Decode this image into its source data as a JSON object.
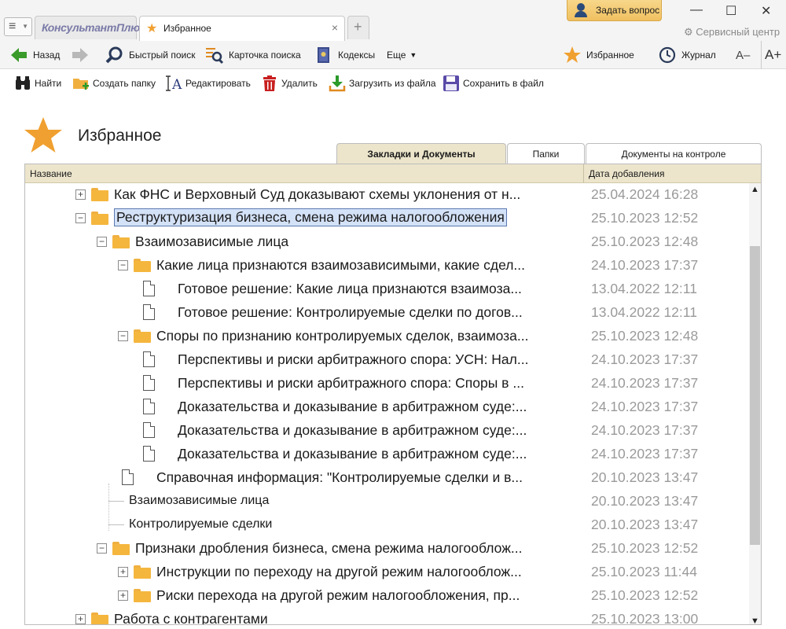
{
  "window": {
    "app_logo": "КонсультантПлюс",
    "active_tab_label": "Избранное",
    "close_glyph": "×",
    "new_tab_glyph": "+",
    "ask_button": "Задать вопрос",
    "service_center": "Сервисный центр",
    "minimize": "—",
    "maximize": "☐",
    "close": "✕"
  },
  "toolbar": {
    "back": "Назад",
    "quick_search": "Быстрый поиск",
    "search_card": "Карточка поиска",
    "codexes": "Кодексы",
    "more": "Еще",
    "favorites": "Избранное",
    "journal": "Журнал",
    "font_smaller": "A–",
    "font_larger": "A+"
  },
  "actions": {
    "find": "Найти",
    "create_folder": "Создать папку",
    "edit": "Редактировать",
    "delete": "Удалить",
    "load_from_file": "Загрузить из файла",
    "save_to_file": "Сохранить в файл"
  },
  "page": {
    "title": "Избранное"
  },
  "view_tabs": [
    {
      "label": "Закладки и Документы",
      "selected": true
    },
    {
      "label": "Папки",
      "selected": false
    },
    {
      "label": "Документы на контроле",
      "selected": false
    }
  ],
  "table": {
    "col_name": "Название",
    "col_date": "Дата добавления",
    "rows": [
      {
        "level": 0,
        "type": "folder",
        "toggle": "+",
        "name": "Как ФНС и Верховный Суд доказывают схемы уклонения от н...",
        "date": "25.04.2024 16:28"
      },
      {
        "level": 0,
        "type": "folder",
        "toggle": "−",
        "name": "Реструктуризация бизнеса, смена режима налогообложения",
        "date": "25.10.2023 12:52",
        "selected": true
      },
      {
        "level": 1,
        "type": "folder",
        "toggle": "−",
        "name": "Взаимозависимые лица",
        "date": "25.10.2023 12:48"
      },
      {
        "level": 2,
        "type": "folder",
        "toggle": "−",
        "name": "Какие лица признаются взаимозависимыми, какие сдел...",
        "date": "24.10.2023 17:37"
      },
      {
        "level": 3,
        "type": "doc",
        "name": "Готовое решение: Какие лица признаются взаимоза...",
        "date": "13.04.2022 12:11"
      },
      {
        "level": 3,
        "type": "doc",
        "name": "Готовое решение: Контролируемые сделки по догов...",
        "date": "13.04.2022 12:11"
      },
      {
        "level": 2,
        "type": "folder",
        "toggle": "−",
        "name": "Споры по признанию контролируемых сделок, взаимоза...",
        "date": "25.10.2023 12:48"
      },
      {
        "level": 3,
        "type": "doc",
        "name": "Перспективы и риски арбитражного спора: УСН: Нал...",
        "date": "24.10.2023 17:37"
      },
      {
        "level": 3,
        "type": "doc",
        "name": "Перспективы и риски арбитражного спора: Споры в ...",
        "date": "24.10.2023 17:37"
      },
      {
        "level": 3,
        "type": "doc",
        "name": "Доказательства и доказывание в арбитражном суде:...",
        "date": "24.10.2023 17:37"
      },
      {
        "level": 3,
        "type": "doc",
        "name": "Доказательства и доказывание в арбитражном суде:...",
        "date": "24.10.2023 17:37"
      },
      {
        "level": 3,
        "type": "doc",
        "name": "Доказательства и доказывание в арбитражном суде:...",
        "date": "24.10.2023 17:37"
      },
      {
        "level": 2,
        "type": "doc",
        "name": "Справочная информация: \"Контролируемые сделки и в...",
        "date": "20.10.2023 13:47"
      },
      {
        "level": 2,
        "type": "bookmark",
        "name": "Взаимозависимые лица",
        "date": "20.10.2023 13:47"
      },
      {
        "level": 2,
        "type": "bookmark",
        "name": "Контролируемые сделки",
        "date": "20.10.2023 13:47"
      },
      {
        "level": 1,
        "type": "folder",
        "toggle": "−",
        "name": "Признаки дробления бизнеса, смена режима налогооблож...",
        "date": "25.10.2023 12:52"
      },
      {
        "level": 2,
        "type": "folder",
        "toggle": "+",
        "name": "Инструкции по переходу на другой режим налогооблож...",
        "date": "25.10.2023 11:44"
      },
      {
        "level": 2,
        "type": "folder",
        "toggle": "+",
        "name": "Риски перехода на другой режим налогообложения, пр...",
        "date": "25.10.2023 12:52"
      },
      {
        "level": 0,
        "type": "folder",
        "toggle": "+",
        "name": "Работа с контрагентами",
        "date": "25.10.2023 13:00"
      }
    ]
  },
  "scroll": {
    "up": "▲",
    "down": "▼"
  },
  "colors": {
    "accent_star": "#f0a030",
    "header_bg": "#ece5cc",
    "selection": "#d4e2f8"
  }
}
